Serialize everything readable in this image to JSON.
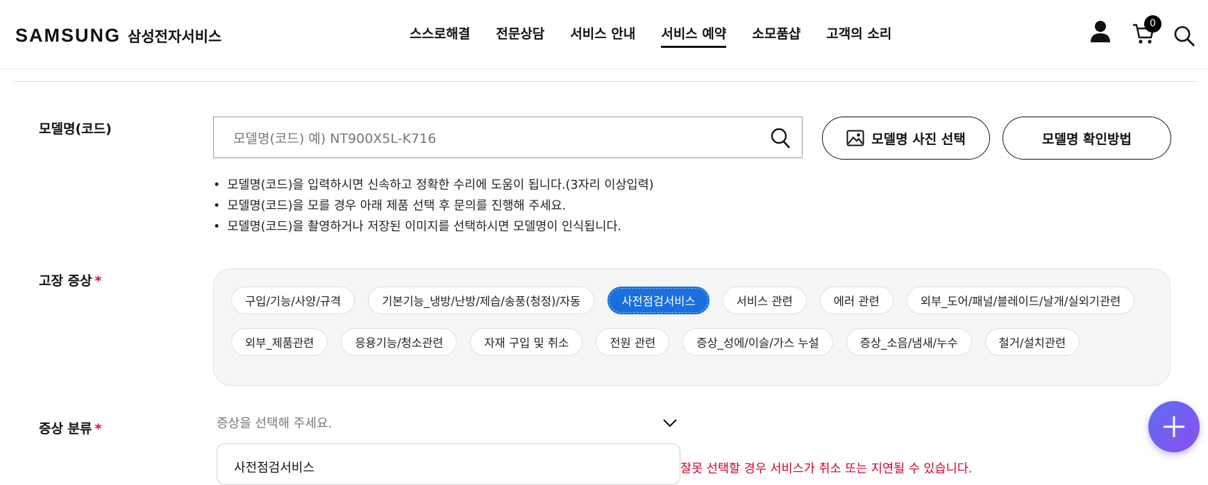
{
  "header": {
    "brand": "SAMSUNG",
    "brand_sub": "삼성전자서비스",
    "nav": [
      "스스로해결",
      "전문상담",
      "서비스 안내",
      "서비스 예약",
      "소모품샵",
      "고객의 소리"
    ],
    "active_nav": "서비스 예약",
    "cart_count": "0",
    "icons": [
      "user-icon",
      "cart-icon",
      "search-icon"
    ]
  },
  "model": {
    "label": "모델명(코드)",
    "placeholder": "모델명(코드) 예) NT900X5L-K716",
    "photo_button": "모델명 사진 선택",
    "check_button": "모델명 확인방법",
    "notes": [
      "모델명(코드)을 입력하시면 신속하고 정확한 수리에 도움이 됩니다.(3자리 이상입력)",
      "모델명(코드)을 모를 경우 아래 제품 선택 후 문의를 진행해 주세요.",
      "모델명(코드)을 촬영하거나 저장된 이미지를 선택하시면 모델명이 인식됩니다."
    ]
  },
  "symptom": {
    "label": "고장 증상",
    "required_mark": "*",
    "chips_row1": [
      "구입/기능/사양/규격",
      "기본기능_냉방/난방/제습/송풍(청정)/자동",
      "사전점검서비스",
      "서비스 관련",
      "에러 관련",
      "외부_도어/패널/블레이드/날개/실외기관련"
    ],
    "chips_row2": [
      "외부_제품관련",
      "응용기능/청소관련",
      "자재 구입 및 취소",
      "전원 관련",
      "증상_성에/이슬/가스 누설",
      "증상_소음/냄새/누수",
      "철거/설치관련"
    ],
    "selected": "사전점검서비스"
  },
  "symptom_type": {
    "label": "증상 분류",
    "required_mark": "*",
    "placeholder": "증상을 선택해 주세요.",
    "dropdown_option": "사전점검서비스",
    "warning": "잘못 선택할 경우 서비스가 취소 또는 지연될 수 있습니다."
  },
  "colors": {
    "accent": "#1a6fdc",
    "warning": "#d2002d",
    "fab": "#7a5cf0"
  }
}
